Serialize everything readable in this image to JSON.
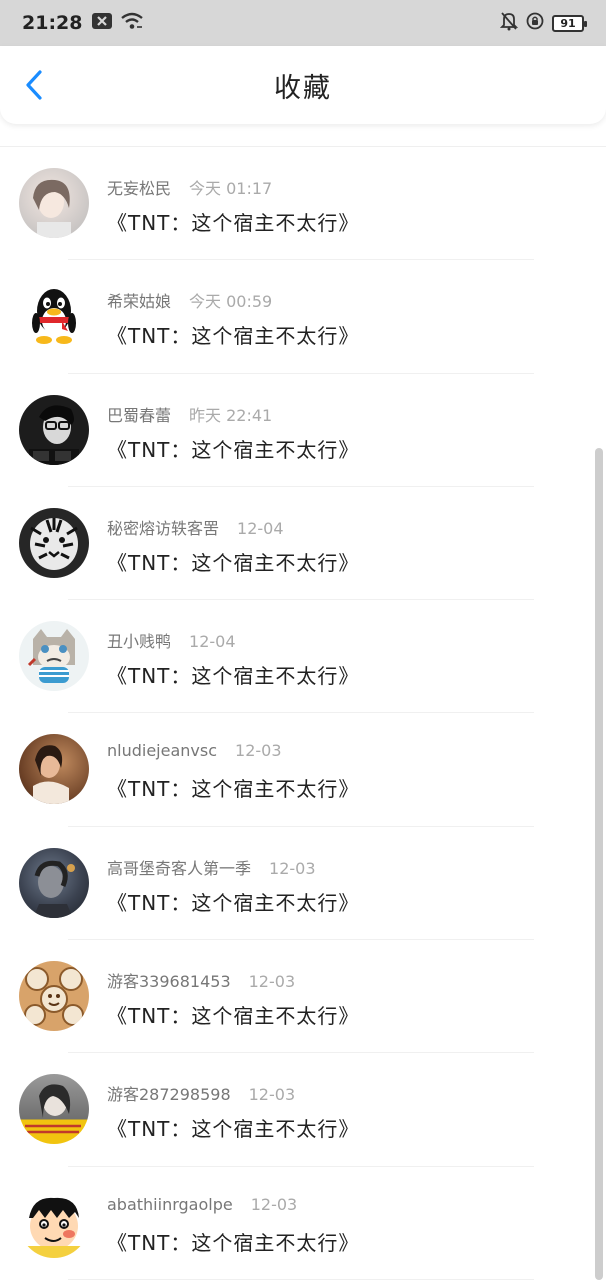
{
  "status_bar": {
    "time": "21:28",
    "battery": "91"
  },
  "header": {
    "title": "收藏"
  },
  "items": [
    {
      "name": "无妄松民",
      "time": "今天 01:17",
      "book": "《TNT：这个宿主不太行》",
      "avatar_color": "#cfcfcf"
    },
    {
      "name": "希荣姑娘",
      "time": "今天 00:59",
      "book": "《TNT：这个宿主不太行》",
      "avatar_color": "#ffffff"
    },
    {
      "name": "巴蜀春蕾",
      "time": "昨天 22:41",
      "book": "《TNT：这个宿主不太行》",
      "avatar_color": "#1c1c1c"
    },
    {
      "name": "秘密熔访轶客罟",
      "time": "12-04",
      "book": "《TNT：这个宿主不太行》",
      "avatar_color": "#2a2a2a"
    },
    {
      "name": "丑小贱鸭",
      "time": "12-04",
      "book": "《TNT：这个宿主不太行》",
      "avatar_color": "#eef3f4"
    },
    {
      "name": "nludiejeanvsc",
      "time": "12-03",
      "book": "《TNT：这个宿主不太行》",
      "avatar_color": "#7a4a2c"
    },
    {
      "name": "高哥堡奇客人第一季",
      "time": "12-03",
      "book": "《TNT：这个宿主不太行》",
      "avatar_color": "#3b4250"
    },
    {
      "name": "游客339681453",
      "time": "12-03",
      "book": "《TNT：这个宿主不太行》",
      "avatar_color": "#d8a36a"
    },
    {
      "name": "游客287298598",
      "time": "12-03",
      "book": "《TNT：这个宿主不太行》",
      "avatar_color": "#8a8a8a"
    },
    {
      "name": "abathiinrgaolpe",
      "time": "12-03",
      "book": "《TNT：这个宿主不太行》",
      "avatar_color": "#f4d03f"
    }
  ],
  "icons": {
    "back": "back-arrow-icon",
    "status_left": [
      "notification-x-icon",
      "wifi-icon"
    ],
    "status_right": [
      "mute-bell-icon",
      "dnd-icon"
    ]
  },
  "colors": {
    "accent": "#1a8cff",
    "status_bar": "#d7d7d7"
  }
}
